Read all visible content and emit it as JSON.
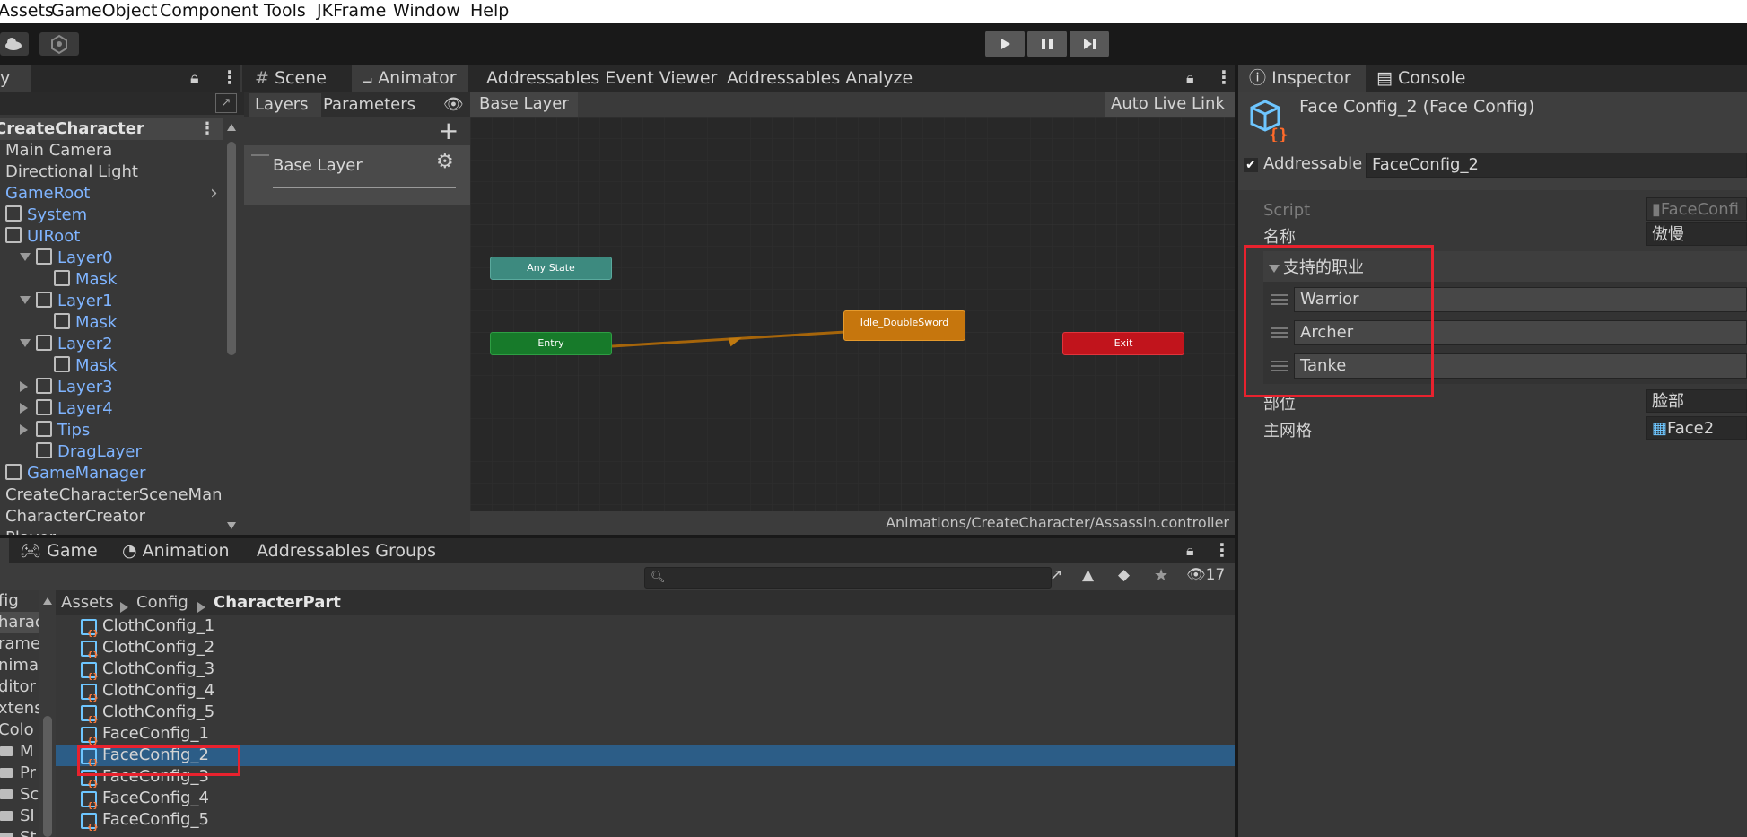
{
  "menubar": {
    "items": [
      "Assets",
      "GameObject",
      "Component",
      "Tools",
      "JKFrame",
      "Window",
      "Help"
    ]
  },
  "hierarchy": {
    "tab_label": "y",
    "scene_name": "CreateCharacter",
    "items": [
      {
        "label": "Main Camera",
        "depth": 0,
        "blue": false,
        "cube": false,
        "arrow": ""
      },
      {
        "label": "Directional Light",
        "depth": 0,
        "blue": false,
        "cube": false,
        "arrow": ""
      },
      {
        "label": "GameRoot",
        "depth": 0,
        "blue": true,
        "cube": false,
        "arrow": "right-end"
      },
      {
        "label": "System",
        "depth": 0,
        "blue": true,
        "cube": true,
        "arrow": ""
      },
      {
        "label": "UIRoot",
        "depth": 0,
        "blue": true,
        "cube": true,
        "arrow": ""
      },
      {
        "label": "Layer0",
        "depth": 1,
        "blue": true,
        "cube": true,
        "arrow": "down"
      },
      {
        "label": "Mask",
        "depth": 2,
        "blue": true,
        "cube": true,
        "arrow": ""
      },
      {
        "label": "Layer1",
        "depth": 1,
        "blue": true,
        "cube": true,
        "arrow": "down"
      },
      {
        "label": "Mask",
        "depth": 2,
        "blue": true,
        "cube": true,
        "arrow": ""
      },
      {
        "label": "Layer2",
        "depth": 1,
        "blue": true,
        "cube": true,
        "arrow": "down"
      },
      {
        "label": "Mask",
        "depth": 2,
        "blue": true,
        "cube": true,
        "arrow": ""
      },
      {
        "label": "Layer3",
        "depth": 1,
        "blue": true,
        "cube": true,
        "arrow": "right"
      },
      {
        "label": "Layer4",
        "depth": 1,
        "blue": true,
        "cube": true,
        "arrow": "right"
      },
      {
        "label": "Tips",
        "depth": 1,
        "blue": true,
        "cube": true,
        "arrow": "right"
      },
      {
        "label": "DragLayer",
        "depth": 1,
        "blue": true,
        "cube": true,
        "arrow": ""
      },
      {
        "label": "GameManager",
        "depth": 0,
        "blue": true,
        "cube": true,
        "arrow": ""
      },
      {
        "label": "CreateCharacterSceneMan",
        "depth": 0,
        "blue": false,
        "cube": false,
        "arrow": ""
      },
      {
        "label": "CharacterCreator",
        "depth": 0,
        "blue": false,
        "cube": false,
        "arrow": ""
      },
      {
        "label": "Player",
        "depth": 0,
        "blue": false,
        "cube": false,
        "arrow": ""
      }
    ]
  },
  "center_tabs": [
    "Scene",
    "Animator",
    "Addressables Event Viewer",
    "Addressables Analyze"
  ],
  "animator": {
    "sub_tabs": [
      "Layers",
      "Parameters"
    ],
    "breadcrumb": "Base Layer",
    "auto_live_link": "Auto Live Link",
    "layer_name": "Base Layer",
    "nodes": {
      "any_state": "Any State",
      "entry": "Entry",
      "idle": "Idle_DoubleSword",
      "exit": "Exit"
    },
    "footer_path": "Animations/CreateCharacter/Assassin.controller"
  },
  "right_tabs": [
    "Inspector",
    "Console"
  ],
  "inspector": {
    "title": "Face Config_2 (Face Config)",
    "addressable_label": "Addressable",
    "addressable_checked": true,
    "addressable_value": "FaceConfig_2",
    "script_label": "Script",
    "script_value": "FaceConfi",
    "name_label": "名称",
    "name_value": "傲慢",
    "professions_label": "支持的职业",
    "professions": [
      "Warrior",
      "Archer",
      "Tanke"
    ],
    "part_label": "部位",
    "part_value": "脸部",
    "mesh_label": "主网格",
    "mesh_value": "Face2"
  },
  "bottom_tabs": [
    "Game",
    "Animation",
    "Addressables Groups"
  ],
  "project": {
    "search_placeholder": "",
    "hidden_count": "17",
    "breadcrumb": [
      "Assets",
      "Config",
      "CharacterPart"
    ],
    "folders": [
      "fig",
      "harac",
      "rame",
      "nimat",
      "ditor",
      "xtens",
      "Colo",
      "M",
      "Pr",
      "Sc",
      "SI",
      "St"
    ],
    "assets": [
      "ClothConfig_1",
      "ClothConfig_2",
      "ClothConfig_3",
      "ClothConfig_4",
      "ClothConfig_5",
      "FaceConfig_1",
      "FaceConfig_2",
      "FaceConfig_3",
      "FaceConfig_4",
      "FaceConfig_5"
    ],
    "selected_asset": "FaceConfig_2"
  },
  "colors": {
    "selection": "#2c5d87",
    "highlight_box": "#e8222e",
    "node_any": "#3d8a7f",
    "node_entry": "#177a2a",
    "node_idle": "#c6760d",
    "node_exit": "#c1141c"
  }
}
